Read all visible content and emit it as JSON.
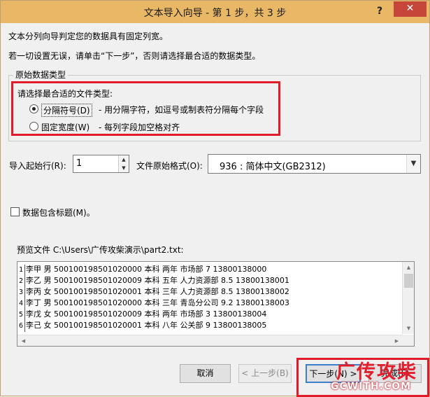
{
  "window": {
    "title": "文本导入向导 - 第 1 步，共 3 步",
    "help_label": "?",
    "close_label": "✕"
  },
  "intro": {
    "line1": "文本分列向导判定您的数据具有固定列宽。",
    "line2": "若一切设置无误，请单击“下一步”，否则请选择最合适的数据类型。"
  },
  "original_type": {
    "group_title": "原始数据类型",
    "prompt": "请选择最合适的文件类型:",
    "options": [
      {
        "label": "分隔符号(D)",
        "description": "- 用分隔字符，如逗号或制表符分隔每个字段",
        "checked": true
      },
      {
        "label": "固定宽度(W)",
        "description": "- 每列字段加空格对齐",
        "checked": false
      }
    ]
  },
  "import_start": {
    "label": "导入起始行(R):",
    "value": "1",
    "up_icon": "triangle-up-icon",
    "down_icon": "triangle-down-icon"
  },
  "file_origin": {
    "label": "文件原始格式(O):",
    "value": "936 : 简体中文(GB2312)",
    "arrow_icon": "chevron-down-icon"
  },
  "header_option": {
    "label": "数据包含标题(M)。",
    "checked": false
  },
  "preview": {
    "label": "预览文件 C:\\Users\\广传攻柴演示\\part2.txt:",
    "rows": [
      {
        "num": "1",
        "text": "李甲 男 500100198501020000 本科 两年 市场部 7 13800138000"
      },
      {
        "num": "2",
        "text": "李乙 男 500100198501020009 本科 五年 人力资源部 8.5 13800138001"
      },
      {
        "num": "3",
        "text": "李丙 女 500100198501020001 本科 三年 人力资源部 8.5 13800138002"
      },
      {
        "num": "4",
        "text": "李丁 男 500100198501020000 本科 三年 青岛分公司 9.2 13800138003"
      },
      {
        "num": "5",
        "text": "李戊 女 500100198501020009 本科 两年 市场部 3 13800138004"
      },
      {
        "num": "6",
        "text": "李己 女 500100198501020001 本科 八年 公关部 9 13800138005"
      }
    ]
  },
  "buttons": {
    "cancel": "取消",
    "prev": "< 上一步(B)",
    "next": "下一步(N) >",
    "finish": "完成(F)"
  },
  "watermark": {
    "big": "广传攻柴",
    "small": "GCWITH.COM"
  },
  "colors": {
    "titlebar": "#e9b867",
    "close": "#c7463a",
    "highlight": "#e11b2a",
    "default_button_border": "#3c7fc9"
  }
}
